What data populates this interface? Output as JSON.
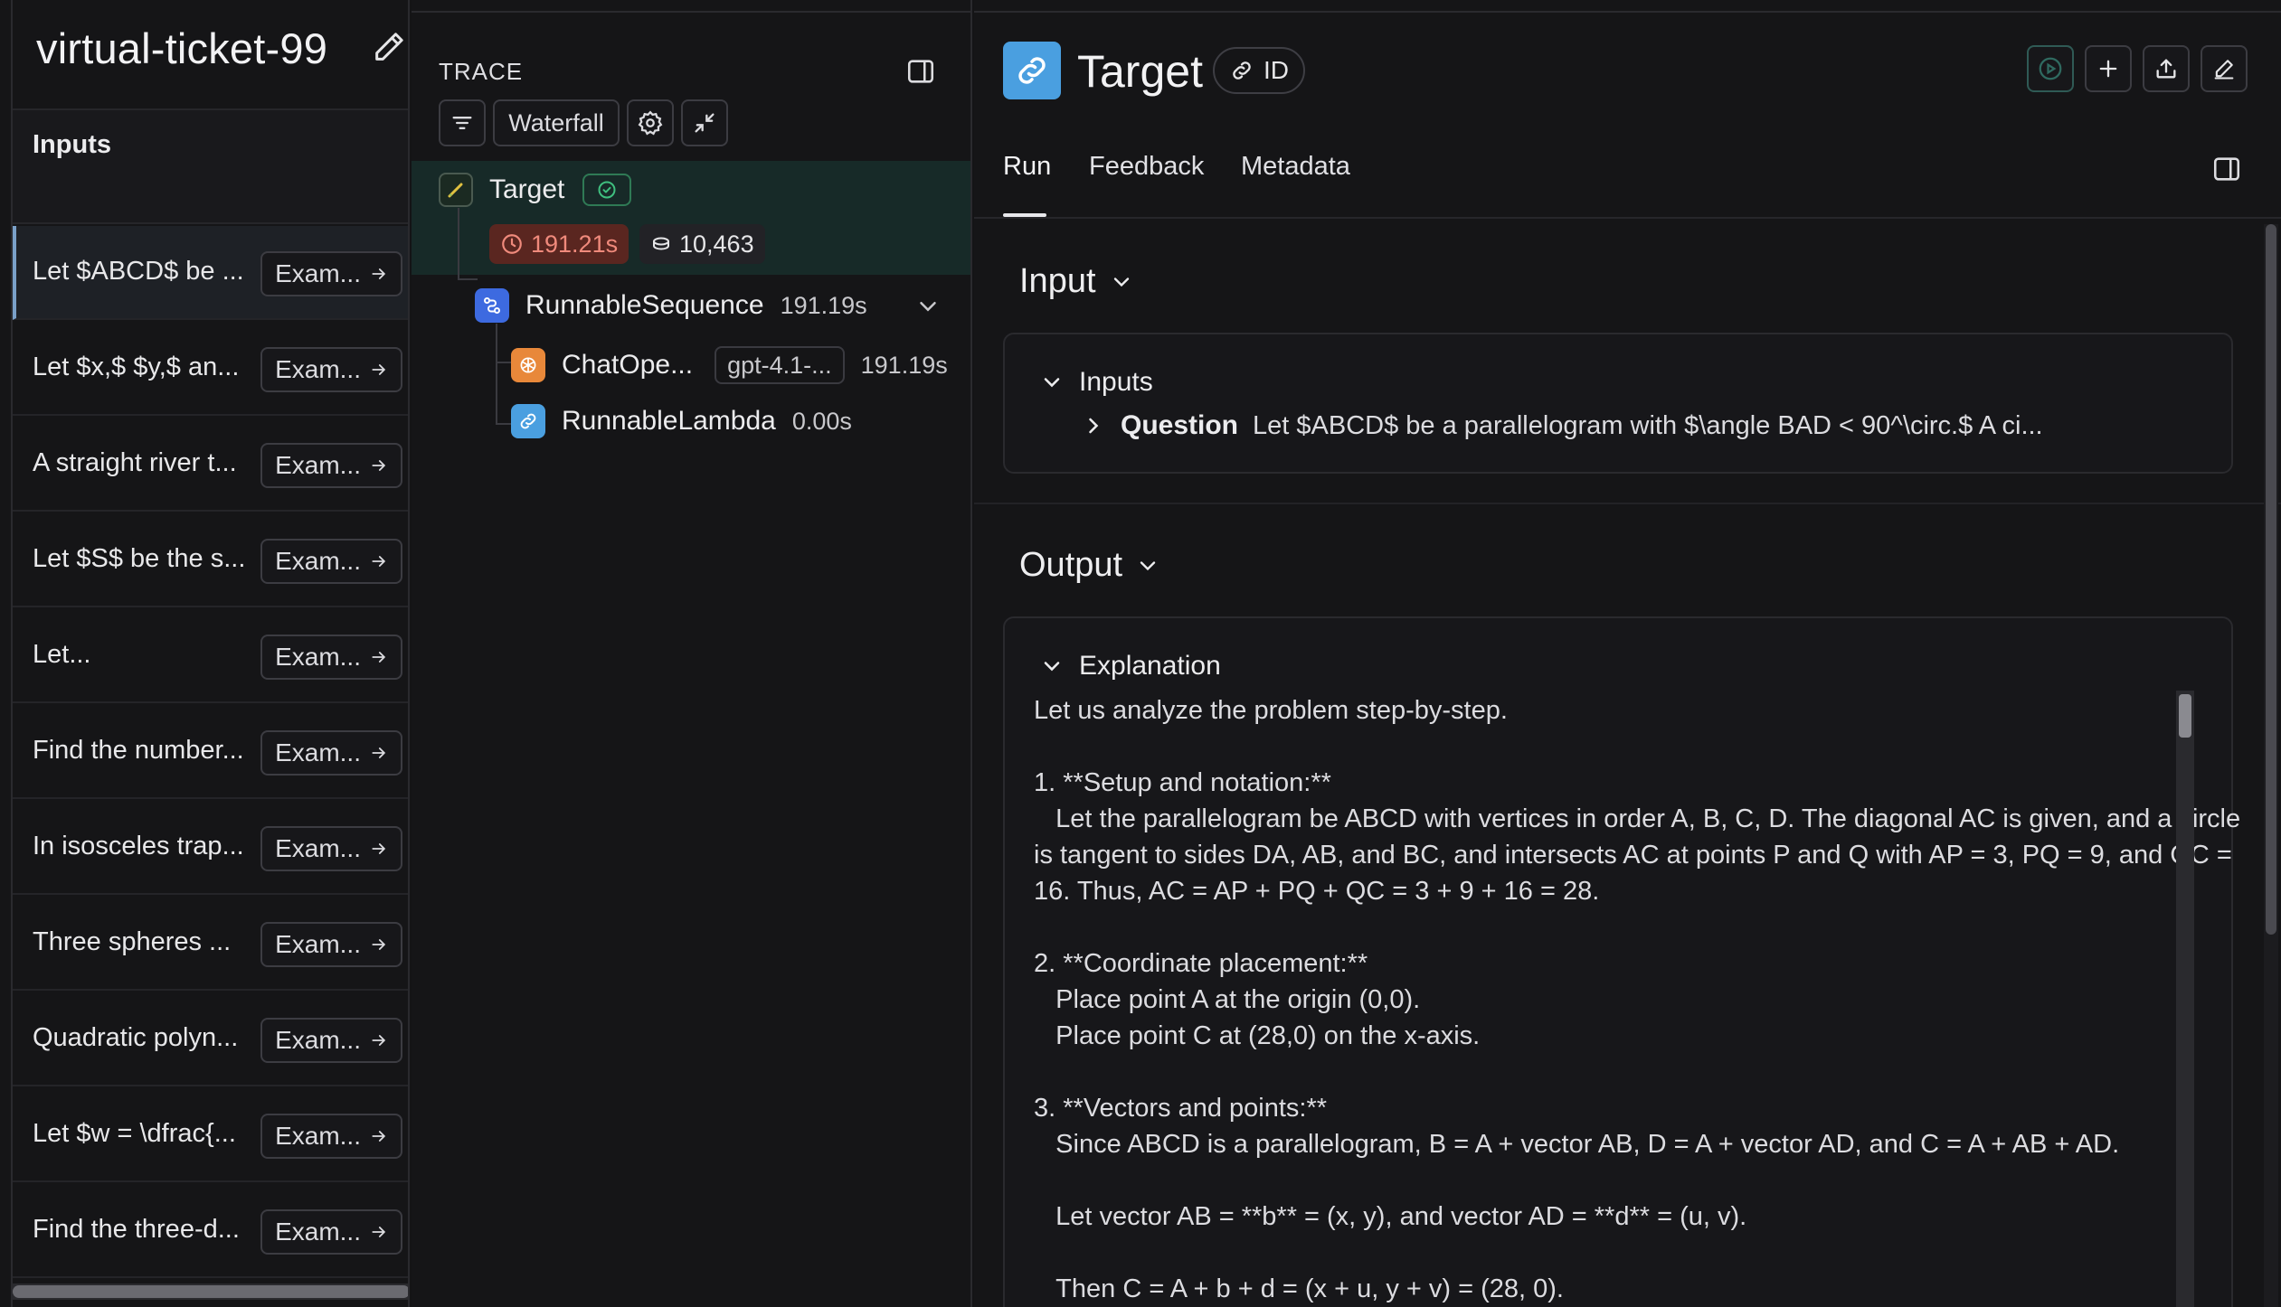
{
  "left": {
    "title": "virtual-ticket-99",
    "inputs_header": "Inputs",
    "rows": [
      {
        "text": "Let $ABCD$ be ...",
        "button": "Exam..."
      },
      {
        "text": "Let $x,$ $y,$ an...",
        "button": "Exam..."
      },
      {
        "text": "A straight river t...",
        "button": "Exam..."
      },
      {
        "text": "Let $S$ be the s...",
        "button": "Exam..."
      },
      {
        "text": "Let...",
        "button": "Exam..."
      },
      {
        "text": "Find the number...",
        "button": "Exam..."
      },
      {
        "text": "In isosceles trap...",
        "button": "Exam..."
      },
      {
        "text": "Three spheres ...",
        "button": "Exam..."
      },
      {
        "text": "Quadratic polyn...",
        "button": "Exam..."
      },
      {
        "text": "Let $w = \\dfrac{...",
        "button": "Exam..."
      },
      {
        "text": "Find the three-d...",
        "button": "Exam..."
      }
    ]
  },
  "trace": {
    "label": "TRACE",
    "waterfall": "Waterfall",
    "target": {
      "name": "Target",
      "latency": "191.21s",
      "tokens": "10,463"
    },
    "sequence": {
      "name": "RunnableSequence",
      "time": "191.19s"
    },
    "chat": {
      "name": "ChatOpe...",
      "model": "gpt-4.1-...",
      "time": "191.19s"
    },
    "lambda": {
      "name": "RunnableLambda",
      "time": "0.00s"
    }
  },
  "run": {
    "title": "Target",
    "id_badge": "ID",
    "tabs": [
      "Run",
      "Feedback",
      "Metadata"
    ],
    "input_section": "Input",
    "inputs_label": "Inputs",
    "question_key": "Question",
    "question_value": "Let $ABCD$ be a parallelogram with $\\angle BAD < 90^\\circ.$ A ci...",
    "output_section": "Output",
    "explanation_label": "Explanation",
    "explanation": "Let us analyze the problem step-by-step.\n\n1. **Setup and notation:**\n   Let the parallelogram be ABCD with vertices in order A, B, C, D. The diagonal AC is given, and a circle is tangent to sides DA, AB, and BC, and intersects AC at points P and Q with AP = 3, PQ = 9, and QC = 16. Thus, AC = AP + PQ + QC = 3 + 9 + 16 = 28.\n\n2. **Coordinate placement:**\n   Place point A at the origin (0,0).\n   Place point C at (28,0) on the x-axis.\n\n3. **Vectors and points:**\n   Since ABCD is a parallelogram, B = A + vector AB, D = A + vector AD, and C = A + AB + AD.\n\n   Let vector AB = **b** = (x, y), and vector AD = **d** = (u, v).\n\n   Then C = A + b + d = (x + u, y + v) = (28, 0).",
    "colors": {
      "accent": "#4a9fe0",
      "latency_bg": "#5a2620",
      "latency_fg": "#f08a7c",
      "success": "#3fbf7f"
    }
  }
}
